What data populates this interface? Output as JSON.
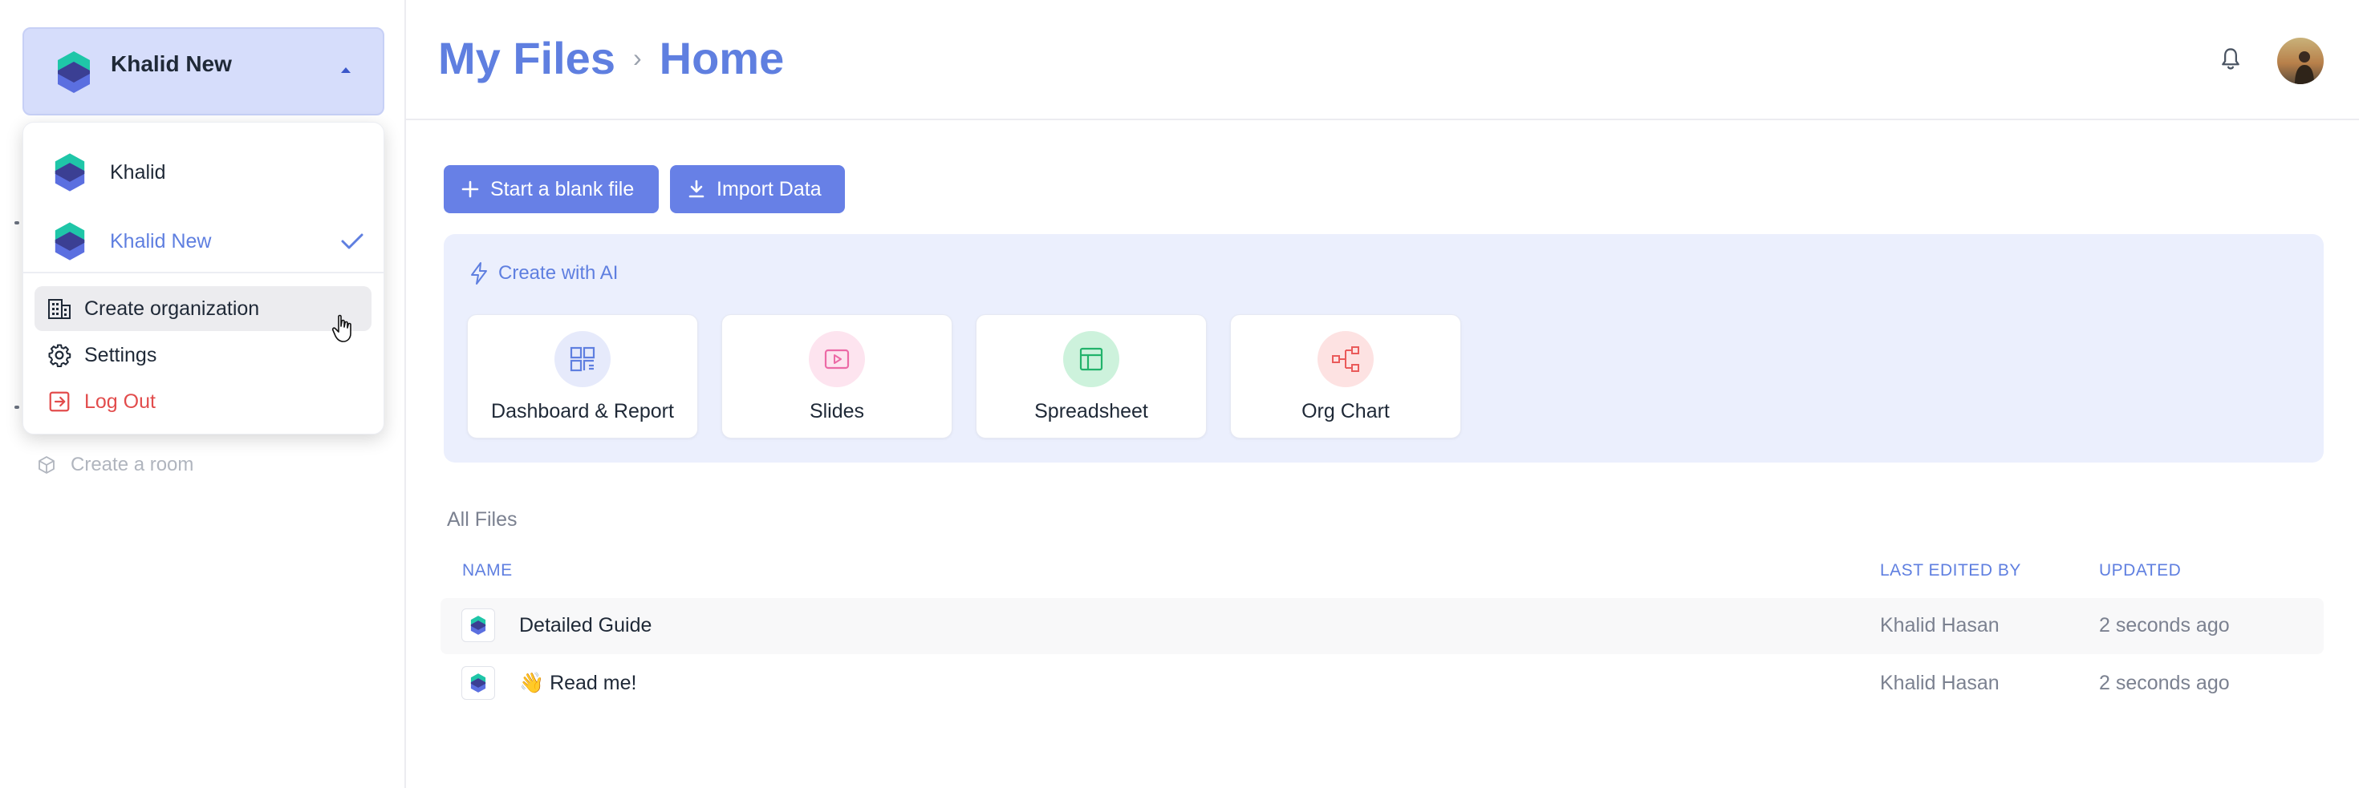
{
  "org_switcher": {
    "current_org": "Khalid New"
  },
  "dropdown": {
    "orgs": [
      {
        "name": "Khalid",
        "active": false
      },
      {
        "name": "Khalid New",
        "active": true
      }
    ],
    "create_org": "Create organization",
    "settings": "Settings",
    "logout": "Log Out"
  },
  "sidebar": {
    "create_room": "Create a room"
  },
  "header": {
    "crumb_root": "My Files",
    "crumb_separator": "›",
    "crumb_current": "Home"
  },
  "actions": {
    "blank_file": "Start a blank file",
    "import_data": "Import Data"
  },
  "ai": {
    "title": "Create with AI",
    "cards": [
      {
        "label": "Dashboard & Report",
        "icon": "dashboard-icon",
        "color": "#5f7fe0"
      },
      {
        "label": "Slides",
        "icon": "slides-icon",
        "color": "#ec6aa6"
      },
      {
        "label": "Spreadsheet",
        "icon": "spreadsheet-icon",
        "color": "#22b36b"
      },
      {
        "label": "Org Chart",
        "icon": "org-chart-icon",
        "color": "#ea5a5a"
      }
    ]
  },
  "files": {
    "section_title": "All Files",
    "columns": {
      "name": "NAME",
      "last_edited_by": "LAST EDITED BY",
      "updated": "UPDATED"
    },
    "rows": [
      {
        "name": "Detailed Guide",
        "editor": "Khalid Hasan",
        "updated": "2 seconds ago"
      },
      {
        "name": "👋 Read me!",
        "editor": "Khalid Hasan",
        "updated": "2 seconds ago"
      }
    ]
  },
  "colors": {
    "accent": "#6780e6",
    "danger": "#e24c4c",
    "panel": "#ebeffd"
  }
}
